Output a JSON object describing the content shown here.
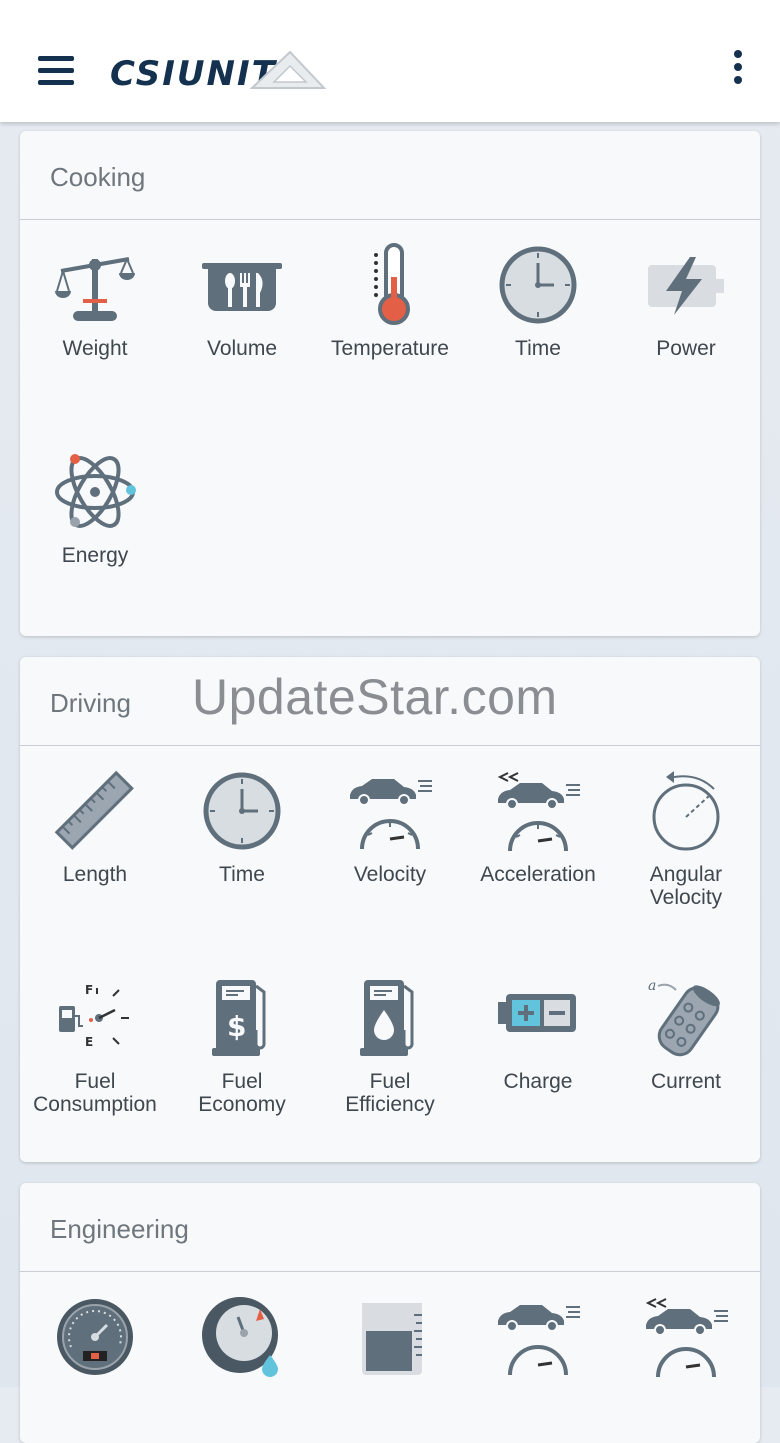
{
  "app": {
    "logo_text": "CSIUNITS"
  },
  "watermark": "UpdateStar.com",
  "colors": {
    "primary": "#14324f",
    "icon_gray": "#5f6f7c",
    "accent_red": "#e35f45",
    "accent_blue": "#62c3dd"
  },
  "sections": [
    {
      "title": "Cooking",
      "items": [
        {
          "label": "Weight",
          "icon": "scale-icon"
        },
        {
          "label": "Volume",
          "icon": "pot-utensils-icon"
        },
        {
          "label": "Temperature",
          "icon": "thermometer-icon"
        },
        {
          "label": "Time",
          "icon": "clock-icon"
        },
        {
          "label": "Power",
          "icon": "battery-bolt-icon"
        },
        {
          "label": "Energy",
          "icon": "atom-icon"
        }
      ]
    },
    {
      "title": "Driving",
      "items": [
        {
          "label": "Length",
          "icon": "ruler-icon"
        },
        {
          "label": "Time",
          "icon": "clock-icon"
        },
        {
          "label": "Velocity",
          "icon": "car-speedometer-icon"
        },
        {
          "label": "Acceleration",
          "icon": "car-acceleration-icon"
        },
        {
          "label_lines": [
            "Angular",
            "Velocity"
          ],
          "icon": "angular-velocity-icon"
        },
        {
          "label_lines": [
            "Fuel",
            "Consumption"
          ],
          "icon": "fuel-gauge-icon"
        },
        {
          "label_lines": [
            "Fuel",
            "Economy"
          ],
          "icon": "fuel-pump-dollar-icon"
        },
        {
          "label_lines": [
            "Fuel",
            "Efficiency"
          ],
          "icon": "fuel-pump-drop-icon"
        },
        {
          "label": "Charge",
          "icon": "battery-charge-icon"
        },
        {
          "label": "Current",
          "icon": "current-icon"
        }
      ]
    },
    {
      "title": "Engineering",
      "items": [
        {
          "icon": "pressure-gauge-icon"
        },
        {
          "icon": "flow-gauge-icon"
        },
        {
          "icon": "beaker-icon"
        },
        {
          "icon": "car-speedometer-icon"
        },
        {
          "icon": "car-acceleration-icon"
        }
      ]
    }
  ]
}
